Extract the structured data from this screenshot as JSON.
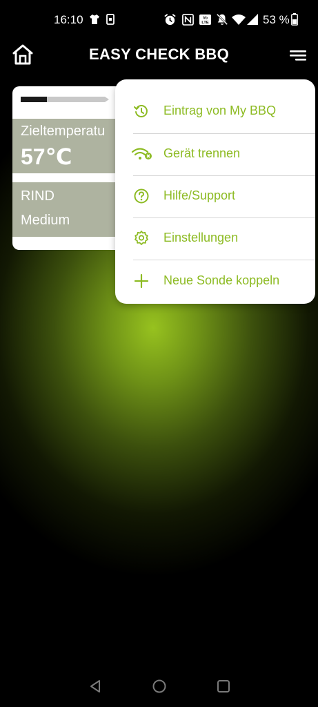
{
  "status_bar": {
    "time": "16:10",
    "battery": "53 %",
    "icons": [
      "shirt-icon",
      "sim-icon",
      "alarm-icon",
      "nfc-icon",
      "volte-icon",
      "mute-icon",
      "wifi-icon",
      "signal-icon",
      "battery-icon"
    ]
  },
  "app_bar": {
    "title": "EASY CHECK BBQ",
    "home_icon": "home-icon",
    "menu_icon": "menu-icon"
  },
  "probe_card": {
    "target_label": "Zieltemperatu",
    "target_value": "57℃",
    "meat": "RIND",
    "doneness": "Medium"
  },
  "menu": {
    "items": [
      {
        "label": "Eintrag von My BBQ",
        "icon": "history-icon"
      },
      {
        "label": "Gerät trennen",
        "icon": "wifi-disconnect-icon"
      },
      {
        "label": "Hilfe/Support",
        "icon": "help-icon"
      },
      {
        "label": "Einstellungen",
        "icon": "settings-icon"
      },
      {
        "label": "Neue Sonde koppeln",
        "icon": "plus-icon"
      }
    ]
  },
  "colors": {
    "accent": "#8dbb23",
    "card_block": "#aeb3a0",
    "glow": "#97c21f"
  },
  "nav_bar": {
    "icons": [
      "back-icon",
      "home-nav-icon",
      "recents-icon"
    ]
  }
}
